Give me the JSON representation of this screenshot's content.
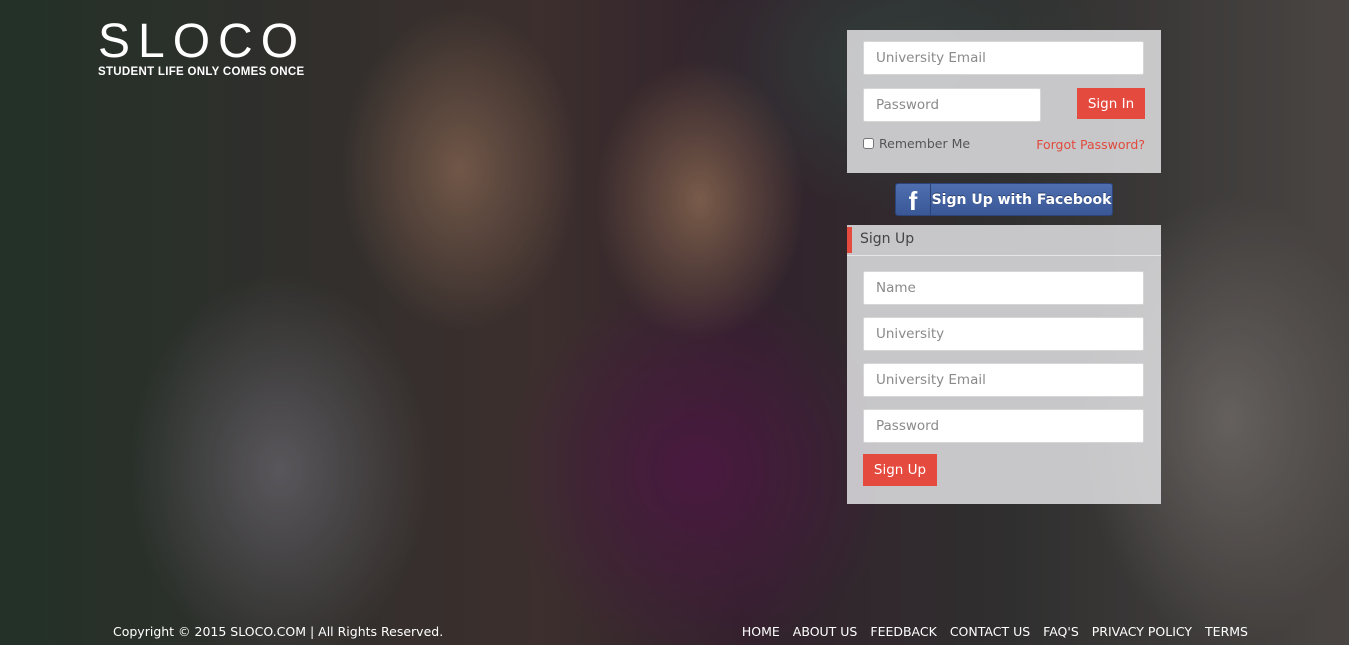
{
  "brand": {
    "name": "SLOCO",
    "tagline": "STUDENT LIFE ONLY COMES ONCE"
  },
  "login": {
    "email_placeholder": "University Email",
    "email_value": "",
    "password_placeholder": "Password",
    "password_value": "",
    "sign_in_label": "Sign In",
    "remember_label": "Remember Me",
    "remember_checked": false,
    "forgot_label": "Forgot Password?"
  },
  "facebook": {
    "icon": "facebook-icon",
    "icon_glyph": "f",
    "label": "Sign Up with Facebook",
    "color": "#3b5998"
  },
  "signup": {
    "title": "Sign Up",
    "name_placeholder": "Name",
    "university_placeholder": "University",
    "email_placeholder": "University Email",
    "password_placeholder": "Password",
    "button_label": "Sign Up"
  },
  "footer": {
    "copyright": "Copyright © 2015 SLOCO.COM  |  All Rights Reserved.",
    "nav": [
      {
        "label": "HOME"
      },
      {
        "label": "ABOUT US"
      },
      {
        "label": "FEEDBACK"
      },
      {
        "label": "CONTACT US"
      },
      {
        "label": "FAQ'S"
      },
      {
        "label": "PRIVACY POLICY"
      },
      {
        "label": "TERMS"
      }
    ]
  },
  "colors": {
    "accent": "#e54a3f",
    "panel_bg": "#dcdcde",
    "link_red": "#e04a3c"
  }
}
